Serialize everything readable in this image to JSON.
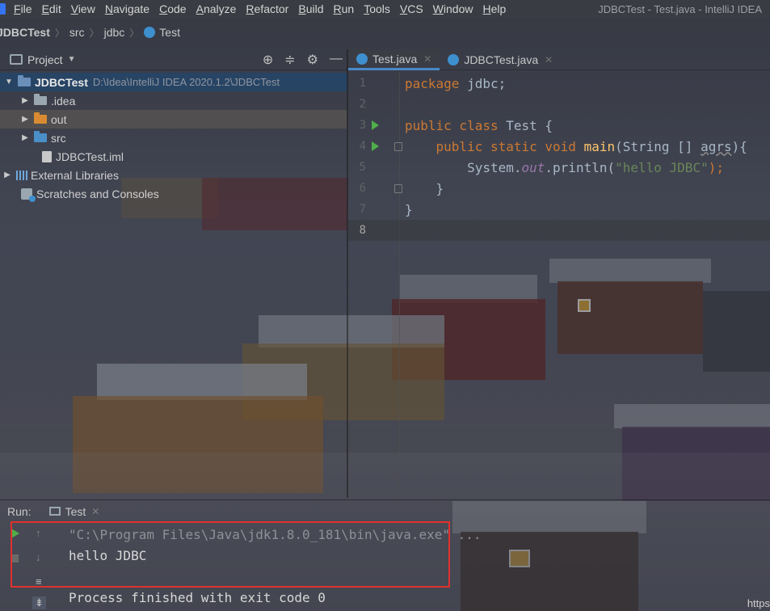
{
  "menubar": {
    "items": [
      "File",
      "Edit",
      "View",
      "Navigate",
      "Code",
      "Analyze",
      "Refactor",
      "Build",
      "Run",
      "Tools",
      "VCS",
      "Window",
      "Help"
    ],
    "window_title": "JDBCTest - Test.java - IntelliJ IDEA"
  },
  "navbar": {
    "project": "JDBCTest",
    "src": "src",
    "package": "jdbc",
    "class": "Test"
  },
  "project_panel": {
    "title": "Project",
    "tree": [
      {
        "label": "JDBCTest",
        "path": "D:\\Idea\\IntelliJ IDEA 2020.1.2\\JDBCTest"
      },
      {
        "label": ".idea"
      },
      {
        "label": "out"
      },
      {
        "label": "src"
      },
      {
        "label": "JDBCTest.iml"
      },
      {
        "label": "External Libraries"
      },
      {
        "label": "Scratches and Consoles"
      }
    ]
  },
  "editor": {
    "tabs": [
      {
        "label": "Test.java"
      },
      {
        "label": "JDBCTest.java"
      }
    ],
    "line_numbers": [
      "1",
      "2",
      "3",
      "4",
      "5",
      "6",
      "7",
      "8"
    ],
    "code": {
      "l1_kw": "package",
      "l1_rest": " jdbc;",
      "l3_kw": "public class",
      "l3_rest": " Test {",
      "l4_indent": "    ",
      "l4_kw": "public static void",
      "l4_sp": " ",
      "l4_fn": "main",
      "l4_args": "(String [] ",
      "l4_typo": "agrs",
      "l4_end": "){",
      "l5_indent": "        System.",
      "l5_static": "out",
      "l5_call": ".println(",
      "l5_str": "\"hello JDBC\"",
      "l5_end": ");",
      "l6": "    }",
      "l7": "}"
    }
  },
  "run_panel": {
    "label": "Run:",
    "tab": "Test",
    "lines": [
      "\"C:\\Program Files\\Java\\jdk1.8.0_181\\bin\\java.exe\" ...",
      "hello JDBC",
      "Process finished with exit code 0"
    ]
  },
  "watermark": "https",
  "colors": {
    "keyword": "#cc7832",
    "function": "#ffc66d",
    "string": "#6a8759",
    "static_field": "#9876aa",
    "highlight_box": "#e0312f"
  }
}
